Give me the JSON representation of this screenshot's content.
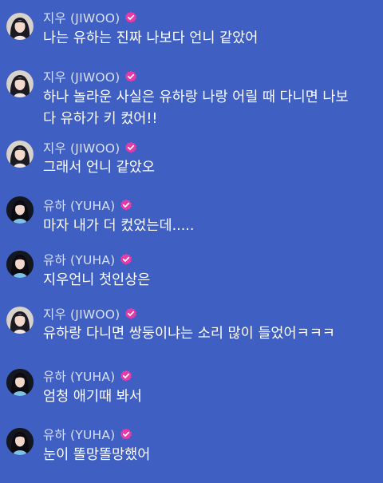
{
  "messages": [
    {
      "user": "지우 (JIWOO)",
      "avatar": "jiwoo-avatar",
      "lines": [
        "나는 유하는 진짜 나보다 언니 같았어"
      ]
    },
    {
      "user": "지우 (JIWOO)",
      "avatar": "jiwoo-avatar",
      "lines": [
        "하나 놀라운 사실은 유하랑 나랑 어릴 때 다니면 나보",
        "다 유하가 키 컸어!!"
      ]
    },
    {
      "user": "지우 (JIWOO)",
      "avatar": "jiwoo-avatar",
      "lines": [
        "그래서 언니 같았오"
      ]
    },
    {
      "user": "유하 (YUHA)",
      "avatar": "yuha-avatar",
      "lines": [
        "마자 내가 더 컸었는데....."
      ]
    },
    {
      "user": "유하 (YUHA)",
      "avatar": "yuha-avatar",
      "lines": [
        "지우언니 첫인상은"
      ]
    },
    {
      "user": "지우 (JIWOO)",
      "avatar": "jiwoo-avatar",
      "lines": [
        "유하랑 다니면 쌍둥이냐는 소리 많이 들었어ㅋㅋㅋ"
      ]
    },
    {
      "user": "유하 (YUHA)",
      "avatar": "yuha-avatar",
      "lines": [
        "엄청 애기때 봐서"
      ]
    },
    {
      "user": "유하 (YUHA)",
      "avatar": "yuha-avatar",
      "lines": [
        "눈이 똘망똘망했어"
      ]
    }
  ],
  "colors": {
    "background": "#3f5fc2",
    "verified_badge": "#e83aa8",
    "username": "#d9e1f7",
    "message_text": "#ffffff"
  },
  "icons": {
    "verified": "verified-badge-icon"
  }
}
